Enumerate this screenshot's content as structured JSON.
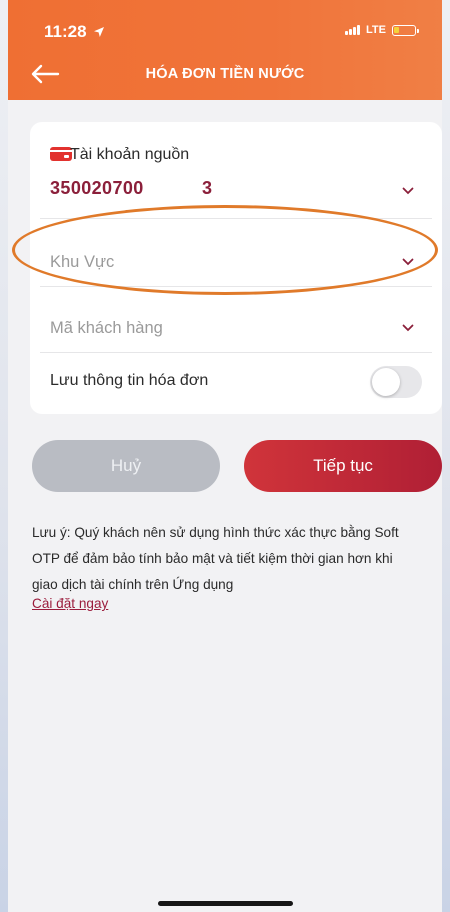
{
  "status_bar": {
    "time": "11:28",
    "network": "LTE"
  },
  "header": {
    "title": "HÓA ĐƠN TIỀN NƯỚC"
  },
  "form": {
    "source_account_label": "Tài khoản nguồn",
    "account_number": "350020700",
    "account_suffix": "3",
    "area_placeholder": "Khu Vực",
    "customer_code_placeholder": "Mã khách hàng",
    "save_invoice_label": "Lưu thông tin hóa đơn",
    "save_invoice_enabled": false
  },
  "actions": {
    "cancel_label": "Huỷ",
    "continue_label": "Tiếp tục"
  },
  "note": {
    "text": "Lưu ý: Quý khách nên sử dụng hình thức xác thực bằng Soft OTP để đảm bảo tính bảo mật và tiết kiệm thời gian hơn khi giao dịch tài chính trên Ứng dụng",
    "link_label": "Cài đặt ngay"
  },
  "colors": {
    "header": "#f0743a",
    "accent": "#c92a3a",
    "account_text": "#8b1f3a",
    "annotation": "#e07a2a"
  }
}
